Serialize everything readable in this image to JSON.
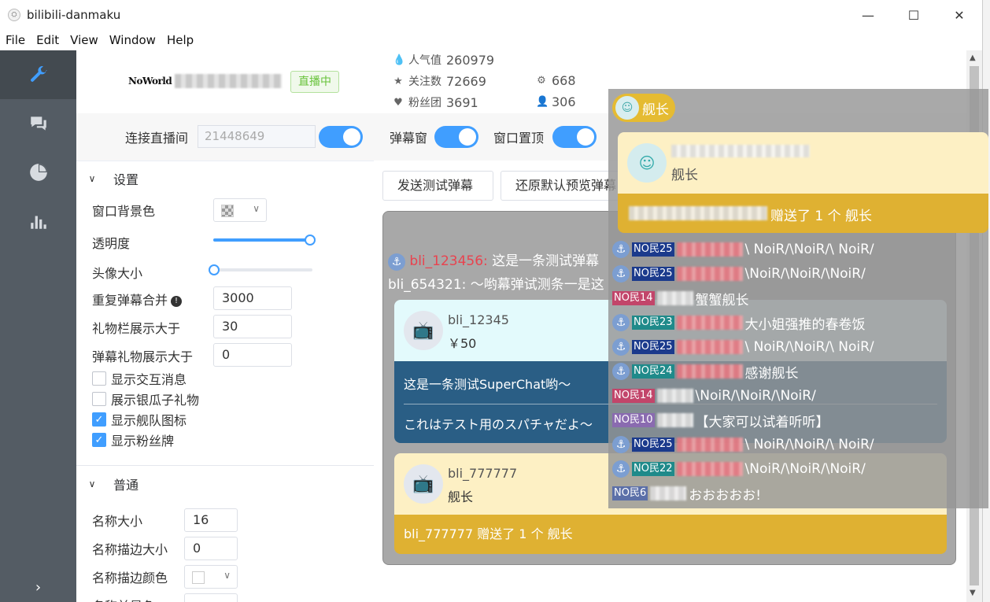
{
  "window": {
    "title": "bilibili-danmaku",
    "icon": "app-icon"
  },
  "menu": [
    "File",
    "Edit",
    "View",
    "Window",
    "Help"
  ],
  "sidebar": {
    "items": [
      {
        "icon": "wrench-icon",
        "active": true
      },
      {
        "icon": "chat-icon",
        "active": false
      },
      {
        "icon": "pie-chart-icon",
        "active": false
      },
      {
        "icon": "bar-chart-icon",
        "active": false
      }
    ],
    "collapse_icon": "chevron-right-icon"
  },
  "room": {
    "logo_text": "NoWorld",
    "live_status": "直播中",
    "stats": {
      "popularity_label": "人气值",
      "popularity": "260979",
      "followers_label": "关注数",
      "followers": "72669",
      "fanclub_label": "粉丝团",
      "fanclub": "3691",
      "count_a": "668",
      "count_b": "306"
    }
  },
  "toolbar": {
    "connect_label": "连接直播间",
    "room_id": "21448649",
    "danmaku_window_label": "弹幕窗",
    "pin_label": "窗口置顶"
  },
  "settings": {
    "section_title": "设置",
    "bg_color_label": "窗口背景色",
    "opacity_label": "透明度",
    "opacity_value": 1.0,
    "avatar_size_label": "头像大小",
    "avatar_size_value": 0.0,
    "merge_label": "重复弹幕合并",
    "merge_value": "3000",
    "gift_bar_label": "礼物栏展示大于",
    "gift_bar_value": "30",
    "gift_danmaku_label": "弹幕礼物展示大于",
    "gift_danmaku_value": "0",
    "checks": [
      {
        "label": "显示交互消息",
        "checked": false
      },
      {
        "label": "展示银瓜子礼物",
        "checked": false
      },
      {
        "label": "显示舰队图标",
        "checked": true
      },
      {
        "label": "显示粉丝牌",
        "checked": true
      }
    ]
  },
  "normal": {
    "section_title": "普通",
    "name_size_label": "名称大小",
    "name_size_value": "16",
    "name_stroke_label": "名称描边大小",
    "name_stroke_value": "0",
    "name_stroke_color_label": "名称描边颜色",
    "name_front_label": "名称前景色"
  },
  "actions": {
    "send_test": "发送测试弹幕",
    "reset_preview": "还原默认预览弹幕"
  },
  "preview": {
    "msg1_user": "bli_123456:",
    "msg1_text": "这是一条测试弹幕",
    "msg2": "bli_654321: ～哟幕弹试测条一是这",
    "sc": {
      "user": "bli_12345",
      "amount": "￥50",
      "text": "这是一条测试SuperChat哟～",
      "text_jp": "これはテスト用のスパチャだよ～"
    },
    "guard": {
      "user": "bli_777777",
      "level": "舰长",
      "text": "bli_777777 赠送了 1 个 舰长"
    }
  },
  "overlay": {
    "tab_label": "舰长",
    "card_level": "舰长",
    "card_text": "赠送了 1 个 舰长",
    "lines": [
      {
        "anchor": true,
        "medal": "NO民25",
        "medal_color": "#1b3a8c",
        "text": "\\ NoiR/\\NoiR/\\ NoiR/",
        "red": true
      },
      {
        "anchor": true,
        "medal": "NO民25",
        "medal_color": "#1b3a8c",
        "text": "\\NoiR/\\NoiR/\\NoiR/",
        "red": true
      },
      {
        "anchor": false,
        "medal": "NO民14",
        "medal_color": "#c2456a",
        "text": "蟹蟹舰长",
        "red": false
      },
      {
        "anchor": true,
        "medal": "NO民23",
        "medal_color": "#1f8a8a",
        "text": "大小姐强推的春卷饭",
        "red": true
      },
      {
        "anchor": true,
        "medal": "NO民25",
        "medal_color": "#1b3a8c",
        "text": "\\ NoiR/\\NoiR/\\ NoiR/",
        "red": true
      },
      {
        "anchor": true,
        "medal": "NO民24",
        "medal_color": "#1f8a8a",
        "text": "感谢舰长",
        "red": true
      },
      {
        "anchor": false,
        "medal": "NO民14",
        "medal_color": "#c2456a",
        "text": "\\NoiR/\\NoiR/\\NoiR/",
        "red": false
      },
      {
        "anchor": false,
        "medal": "NO民10",
        "medal_color": "#8a6bb0",
        "text": "【大家可以试着听听】",
        "red": false
      },
      {
        "anchor": true,
        "medal": "NO民25",
        "medal_color": "#1b3a8c",
        "text": "\\ NoiR/\\NoiR/\\ NoiR/",
        "red": true
      },
      {
        "anchor": true,
        "medal": "NO民22",
        "medal_color": "#1f8a8a",
        "text": "\\NoiR/\\NoiR/\\NoiR/",
        "red": true
      },
      {
        "anchor": false,
        "medal": "NO民6",
        "medal_color": "#5b6fa8",
        "text": "おおおおお!",
        "red": false
      }
    ]
  },
  "colors": {
    "accent": "#409eff",
    "sidebar": "#545c64",
    "guard_gold": "#dfb132",
    "live_green": "#67c23a"
  }
}
